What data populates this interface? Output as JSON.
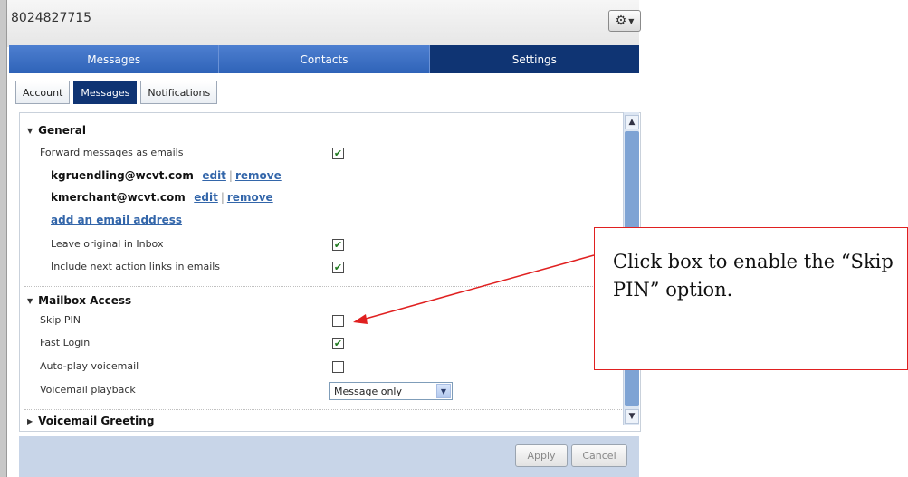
{
  "window": {
    "title": "8024827715"
  },
  "main_tabs": [
    "Messages",
    "Contacts",
    "Settings"
  ],
  "sub_tabs": [
    "Account",
    "Messages",
    "Notifications"
  ],
  "general": {
    "header": "General",
    "forward_label": "Forward messages as emails",
    "emails": [
      {
        "address": "kgruendling@wcvt.com",
        "edit": "edit",
        "sep": "|",
        "remove": "remove"
      },
      {
        "address": "kmerchant@wcvt.com",
        "edit": "edit",
        "sep": "|",
        "remove": "remove"
      }
    ],
    "add_email": "add an email address",
    "leave_original_label": "Leave original in Inbox",
    "include_links_label": "Include next action links in emails"
  },
  "mailbox": {
    "header": "Mailbox Access",
    "skip_pin_label": "Skip PIN",
    "fast_login_label": "Fast Login",
    "autoplay_label": "Auto-play voicemail",
    "playback_label": "Voicemail playback",
    "playback_value": "Message only"
  },
  "voicemail_greeting": {
    "header": "Voicemail Greeting"
  },
  "footer": {
    "apply": "Apply",
    "cancel": "Cancel"
  },
  "callout": {
    "text": "Click box to enable the “Skip PIN” option."
  },
  "checkboxes": {
    "forward": true,
    "leave_original": true,
    "include_links": true,
    "skip_pin": false,
    "fast_login": true,
    "autoplay": false
  },
  "icons": {
    "gear": "gear-icon",
    "check": "check-icon",
    "triangle_down": "triangle-down-icon",
    "triangle_right": "triangle-right-icon"
  },
  "colors": {
    "tab_blue": "#2f63b8",
    "tab_active": "#0f3473",
    "annotation_red": "#e02020",
    "check_green": "#1f7a1f"
  }
}
